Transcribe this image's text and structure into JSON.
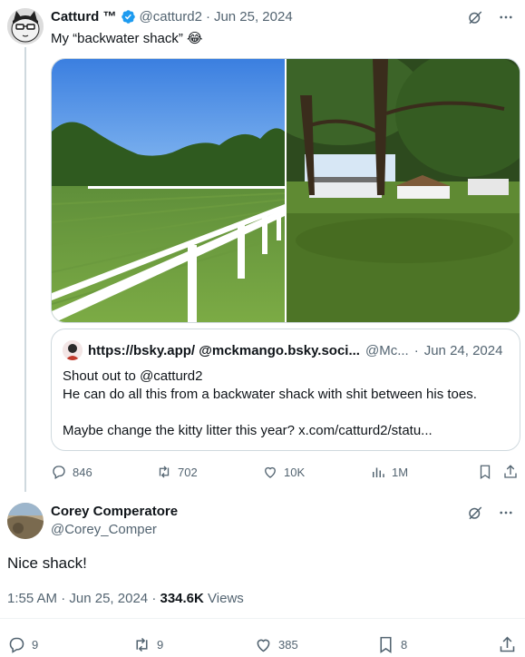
{
  "tweet": {
    "author_name": "Catturd ™",
    "handle": "@catturd2",
    "date": "Jun 25, 2024",
    "text": "My “backwater shack” 😂",
    "more_icon": "more-icon",
    "grok_icon": "grok-icon",
    "quote": {
      "author": "https://bsky.app/ @mckmango.bsky.soci...",
      "handle": "@Mc...",
      "date": "Jun 24, 2024",
      "line1": "Shout out to @catturd2",
      "line2": "He can do all this from a backwater shack with shit between his toes.",
      "line3": "",
      "line4": "Maybe change the kitty litter this year? x.com/catturd2/statu..."
    },
    "stats": {
      "replies": "846",
      "reposts": "702",
      "likes": "10K",
      "views": "1M"
    }
  },
  "reply": {
    "author_name": "Corey Comperatore",
    "handle": "@Corey_Comper",
    "text": "Nice shack!",
    "time": "1:55 AM",
    "date": "Jun 25, 2024",
    "views_count": "334.6K",
    "views_label": "Views",
    "stats": {
      "replies": "9",
      "reposts": "9",
      "likes": "385",
      "bookmarks": "8"
    }
  },
  "colors": {
    "muted": "#536471",
    "verified": "#1d9bf0",
    "border": "#cfd9de"
  }
}
